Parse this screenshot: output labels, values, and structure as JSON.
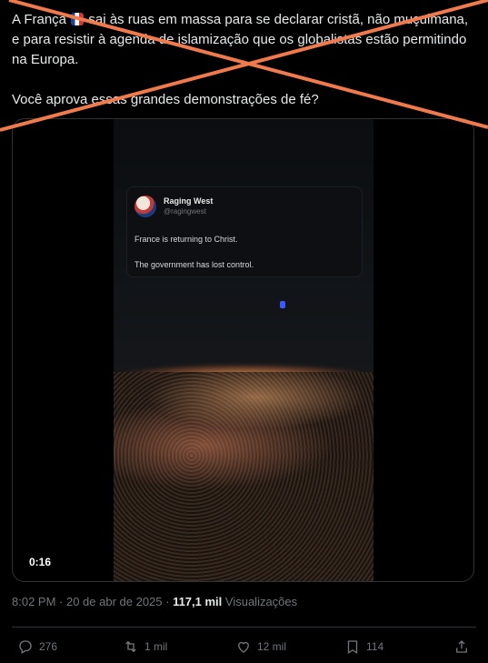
{
  "tweet": {
    "text_before_flag": "A França ",
    "text_after_flag": " sai às ruas em massa para se declarar cristã, não muçulmana, e para resistir à agenda de islamização que os globalistas estão permitindo na Europa.\n\nVocê aprova essas grandes demonstrações de fé?"
  },
  "video": {
    "embedded_post": {
      "author": "Raging West",
      "handle": "@ragingwest",
      "line1": "France is returning to Christ.",
      "line2": "The government has lost control."
    },
    "duration": "0:16"
  },
  "meta": {
    "datetime": "8:02 PM · 20 de abr de 2025 · ",
    "views_count": "117,1 mil",
    "views_label": " Visualizações"
  },
  "actions": {
    "replies": "276",
    "reposts": "1 mil",
    "likes": "12 mil",
    "bookmarks": "114"
  },
  "colors": {
    "background": "#000000",
    "text": "#e7e9ea",
    "muted": "#71767b",
    "cross_overlay": "#f07a4c"
  }
}
